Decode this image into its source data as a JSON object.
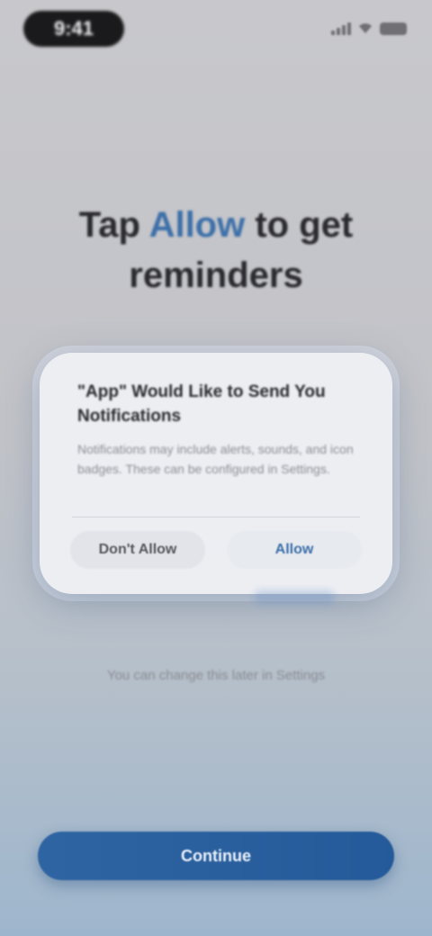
{
  "status_bar": {
    "time": "9:41",
    "signal_icon": "signal-icon",
    "wifi_icon": "wifi-icon",
    "battery_icon": "battery-icon"
  },
  "headline": {
    "prefix": "Tap",
    "accent_word": "Allow",
    "suffix": "to get",
    "line2": "reminders"
  },
  "dialog": {
    "title": "\"App\" Would Like to Send You Notifications",
    "body": "Notifications may include alerts, sounds, and icon badges. These can be configured in Settings.",
    "secondary_label": "Don't Allow",
    "primary_label": "Allow"
  },
  "note": {
    "text": "You can change this later in Settings"
  },
  "cta": {
    "label": "Continue"
  },
  "colors": {
    "accent": "#3c6fa8",
    "cta": "#2f64a2",
    "background_top": "#c8c8cc",
    "background_bottom": "#9eb6cd"
  }
}
